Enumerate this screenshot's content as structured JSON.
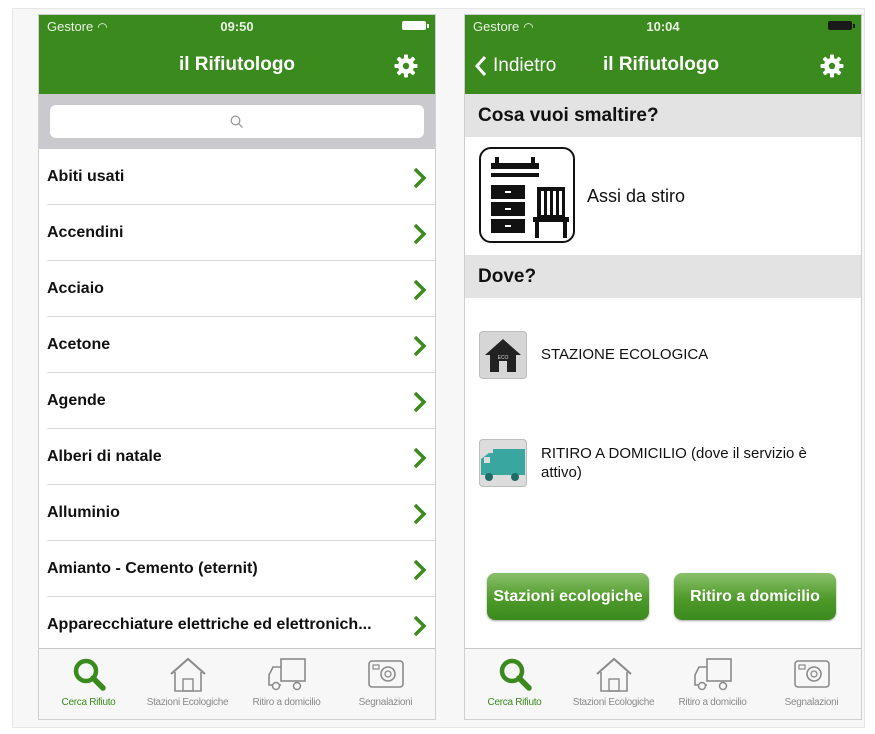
{
  "colors": {
    "brand_green": "#3b8a1e",
    "section_gray": "#e3e3e3",
    "chevron_green": "#3b8a1e",
    "tab_inactive": "#8a8a8a"
  },
  "left_screen": {
    "status": {
      "carrier": "Gestore",
      "time": "09:50"
    },
    "nav": {
      "title": "il Rifiutologo",
      "settings_icon": "gear-icon"
    },
    "search": {
      "placeholder": "",
      "icon": "search-icon"
    },
    "items": [
      {
        "label": "Abiti usati"
      },
      {
        "label": "Accendini"
      },
      {
        "label": "Acciaio"
      },
      {
        "label": "Acetone"
      },
      {
        "label": "Agende"
      },
      {
        "label": "Alberi di natale"
      },
      {
        "label": "Alluminio"
      },
      {
        "label": "Amianto - Cemento (eternit)"
      },
      {
        "label": "Apparecchiature elettriche ed elettronich..."
      }
    ]
  },
  "right_screen": {
    "status": {
      "carrier": "Gestore",
      "time": "10:04"
    },
    "nav": {
      "back_label": "Indietro",
      "title": "il Rifiutologo",
      "settings_icon": "gear-icon"
    },
    "question": "Cosa vuoi smaltire?",
    "item_name": "Assi da stiro",
    "where_header": "Dove?",
    "where_options": [
      {
        "label": "STAZIONE ECOLOGICA",
        "icon": "eco-station-icon"
      },
      {
        "label": "RITIRO A DOMICILIO (dove il servizio è attivo)",
        "icon": "truck-icon"
      }
    ],
    "buttons": {
      "stations": "Stazioni ecologiche",
      "pickup": "Ritiro a domicilio"
    }
  },
  "tabbar": {
    "tabs": [
      {
        "label": "Cerca Rifiuto",
        "icon": "search-icon",
        "active": true
      },
      {
        "label": "Stazioni Ecologiche",
        "icon": "house-icon",
        "active": false
      },
      {
        "label": "Ritiro a domicilio",
        "icon": "truck-icon",
        "active": false
      },
      {
        "label": "Segnalazioni",
        "icon": "camera-icon",
        "active": false
      }
    ]
  }
}
